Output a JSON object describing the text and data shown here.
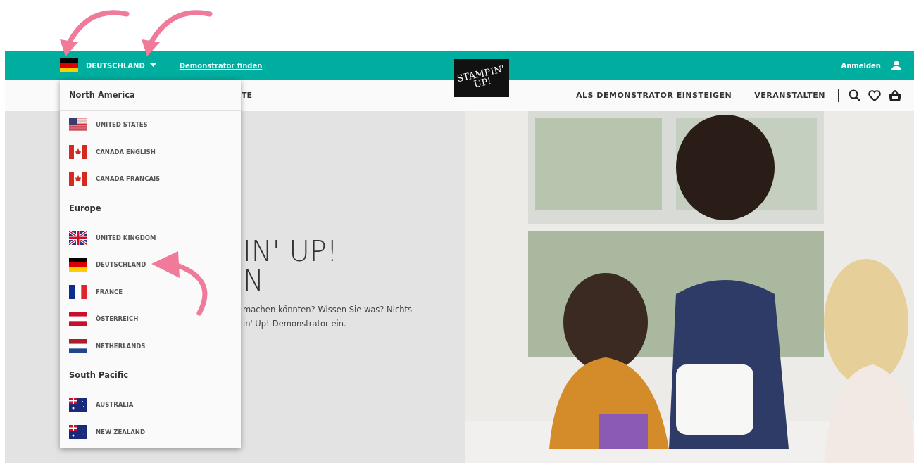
{
  "header": {
    "country": "DEUTSCHLAND",
    "find_link": "Demonstrator finden",
    "sign_in": "Anmelden",
    "logo_text": "STAMPIN' UP!"
  },
  "nav": {
    "cut_item": "TE",
    "items": [
      "ALS DEMONSTRATOR EINSTEIGEN",
      "VERANSTALTEN"
    ]
  },
  "country_menu": {
    "groups": [
      {
        "title": "North America",
        "countries": [
          {
            "name": "UNITED STATES",
            "kind": "us"
          },
          {
            "name": "CANADA ENGLISH",
            "kind": "ca"
          },
          {
            "name": "CANADA FRANCAIS",
            "kind": "ca"
          }
        ]
      },
      {
        "title": "Europe",
        "countries": [
          {
            "name": "UNITED KINGDOM",
            "kind": "uk"
          },
          {
            "name": "DEUTSCHLAND",
            "kind": "de"
          },
          {
            "name": "FRANCE",
            "kind": "fr"
          },
          {
            "name": "ÖSTERREICH",
            "kind": "at"
          },
          {
            "name": "NETHERLANDS",
            "kind": "nl"
          }
        ]
      },
      {
        "title": "South Pacific",
        "countries": [
          {
            "name": "AUSTRALIA",
            "kind": "au"
          },
          {
            "name": "NEW ZEALAND",
            "kind": "nz"
          }
        ]
      }
    ]
  },
  "hero": {
    "title_lines": [
      "IN' UP!",
      "N"
    ],
    "text_lines": [
      "machen könnten? Wissen Sie was? Nichts",
      "in' Up!-Demonstrator ein."
    ]
  }
}
